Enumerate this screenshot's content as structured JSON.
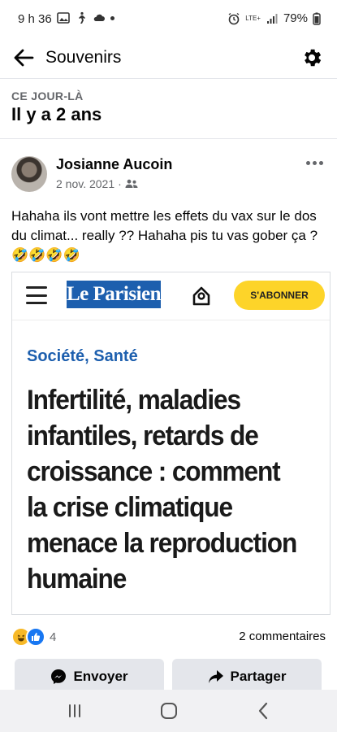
{
  "status_bar": {
    "time": "9 h 36",
    "network": "LTE+",
    "battery": "79%"
  },
  "header": {
    "title": "Souvenirs",
    "back_icon": "arrow-left-icon",
    "settings_icon": "gear-icon"
  },
  "memory": {
    "label": "CE JOUR-LÀ",
    "years_ago": "Il y a 2 ans"
  },
  "post": {
    "author": "Josianne Aucoin",
    "date": "2 nov. 2021",
    "separator": "·",
    "privacy_icon": "friends-icon",
    "text": "Hahaha ils vont mettre les effets du vax sur le dos du climat... really ?? Hahaha pis tu vas gober ça ?",
    "emoji": "🤣🤣🤣🤣"
  },
  "article": {
    "logo": "Le Parisien",
    "subscribe_label": "S'ABONNER",
    "category": "Société, Santé",
    "headline": "Infertilité, maladies infantiles, retards de croissance : comment la crise climatique menace la reproduction humaine"
  },
  "engagement": {
    "reaction_count": "4",
    "comments": "2 commentaires"
  },
  "actions": {
    "send_label": "Envoyer",
    "share_label": "Partager"
  },
  "colors": {
    "facebook_blue": "#1877f2",
    "parisien_blue": "#1d5fae",
    "subscribe_yellow": "#fdd429",
    "secondary_text": "#65676b",
    "button_gray": "#e4e6eb"
  }
}
